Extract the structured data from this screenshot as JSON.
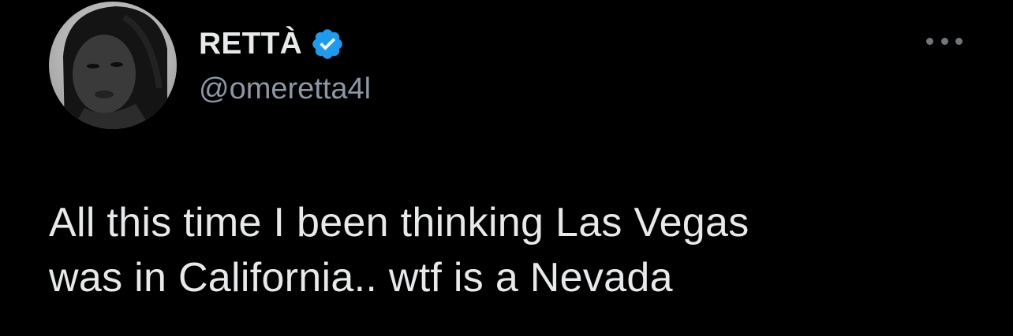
{
  "author": {
    "display_name": "RETTÀ",
    "handle": "@omeretta4l",
    "verified": true
  },
  "tweet": {
    "text": "All this time I been thinking Las Vegas\nwas in California.. wtf is a Nevada"
  },
  "icons": {
    "verified": "verified-badge-icon",
    "more": "more-options-icon",
    "avatar": "profile-photo"
  },
  "colors": {
    "background": "#000000",
    "text": "#e7e9ea",
    "secondary_text": "#8b98a5",
    "verified_blue": "#1d9bf0"
  }
}
